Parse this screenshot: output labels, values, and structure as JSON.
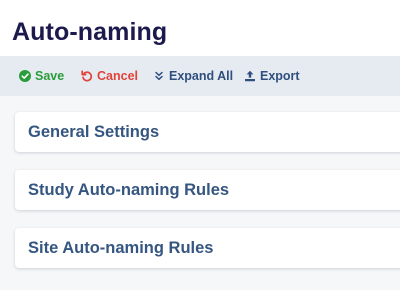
{
  "header": {
    "title": "Auto-naming"
  },
  "toolbar": {
    "save_label": "Save",
    "cancel_label": "Cancel",
    "expand_all_label": "Expand All",
    "export_label": "Export",
    "icons": {
      "save": "check-circle-icon",
      "cancel": "undo-icon",
      "expand_all": "double-chevron-down-icon",
      "export": "upload-icon"
    },
    "colors": {
      "save": "#2a9d3a",
      "cancel": "#e0433a",
      "default": "#2f4f7f"
    }
  },
  "sections": [
    {
      "title": "General Settings"
    },
    {
      "title": "Study Auto-naming Rules"
    },
    {
      "title": "Site Auto-naming Rules"
    }
  ]
}
